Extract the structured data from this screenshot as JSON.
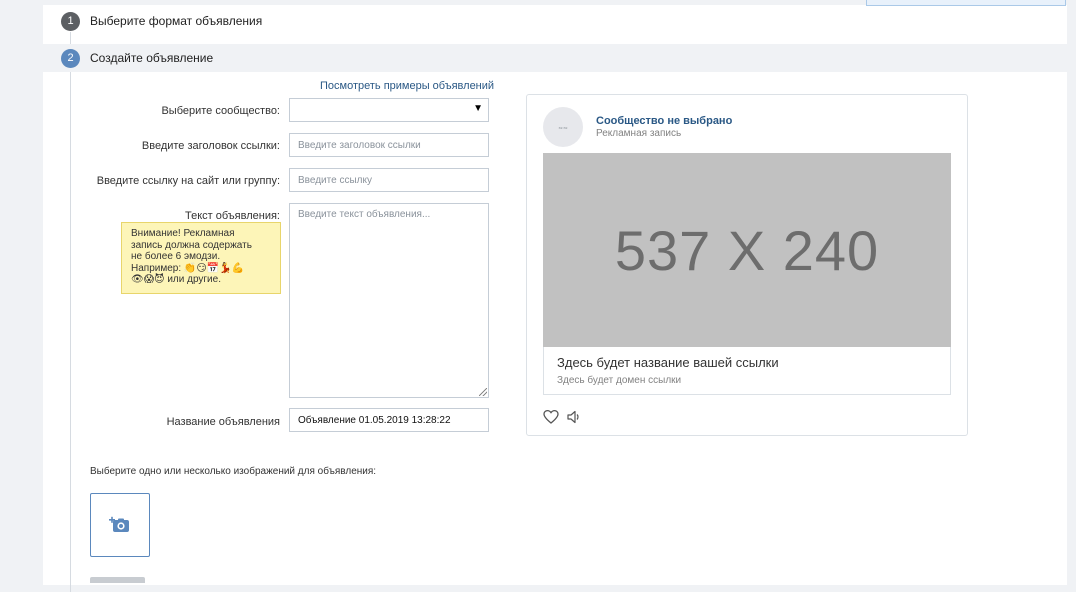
{
  "steps": [
    {
      "number": "1",
      "title": "Выберите формат объявления"
    },
    {
      "number": "2",
      "title": "Создайте объявление"
    }
  ],
  "form": {
    "examples_link": "Посмотреть примеры объявлений",
    "community_label": "Выберите сообщество:",
    "community_value": "",
    "link_title_label": "Введите заголовок ссылки:",
    "link_title_placeholder": "Введите заголовок ссылки",
    "link_url_label": "Введите ссылку на сайт или группу:",
    "link_url_placeholder": "Введите ссылку",
    "ad_text_label": "Текст объявления:",
    "ad_text_placeholder": "Введите текст объявления...",
    "warning": {
      "line1": "Внимание! Рекламная",
      "line2": "запись должна содержать",
      "line3": "не более 6 эмодзи.",
      "line4_prefix": "Например:",
      "line4_emoji": "👏😏📅💃💪",
      "line5_emoji": "👁😱😈",
      "line5_suffix": "или другие."
    },
    "ad_name_label": "Название объявления",
    "ad_name_value": "Объявление 01.05.2019 13:28:22",
    "images_label": "Выберите одно или несколько изображений для объявления:"
  },
  "preview": {
    "avatar_text": "вк вк",
    "community_name": "Сообщество не выбрано",
    "post_type": "Рекламная запись",
    "image_placeholder": "537 X 240",
    "link_title": "Здесь будет название вашей ссылки",
    "link_domain": "Здесь будет домен ссылки"
  },
  "colors": {
    "accent": "#5b88bd",
    "link": "#2a5885",
    "warning_bg": "#fdf5b8"
  }
}
